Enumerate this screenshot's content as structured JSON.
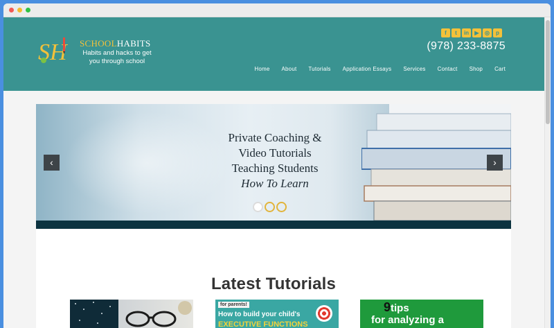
{
  "header": {
    "logo_initials": "SH",
    "logo_name_part1": "SCHOOL",
    "logo_name_part2": "HABITS",
    "tagline": "Habits and hacks to get you through school",
    "phone": "(978) 233-8875",
    "social_icons": [
      "facebook-icon",
      "twitter-icon",
      "linkedin-icon",
      "youtube-icon",
      "instagram-icon",
      "pinterest-icon"
    ],
    "nav": [
      "Home",
      "About",
      "Tutorials",
      "Application Essays",
      "Services",
      "Contact",
      "Shop",
      "Cart"
    ]
  },
  "slider": {
    "line1": "Private Coaching &",
    "line2": "Video Tutorials",
    "line3": "Teaching Students",
    "line4": "How To Learn",
    "prev_icon": "chevron-left-icon",
    "next_icon": "chevron-right-icon",
    "slide_count": 3,
    "active_slide": 1
  },
  "main": {
    "section_title": "Latest Tutorials",
    "tutorials": [
      {
        "kind": "photo"
      },
      {
        "tag": "for parents!",
        "title": "How to build your child's",
        "subtitle": "EXECUTIVE FUNCTIONS"
      },
      {
        "number": "9",
        "word": "tips",
        "line": "for analyzing a"
      }
    ]
  },
  "colors": {
    "header_bg": "#3a9391",
    "accent_gold": "#f3c13a",
    "slider_bar": "#0c3340",
    "page_bg": "#4a8fe0"
  }
}
